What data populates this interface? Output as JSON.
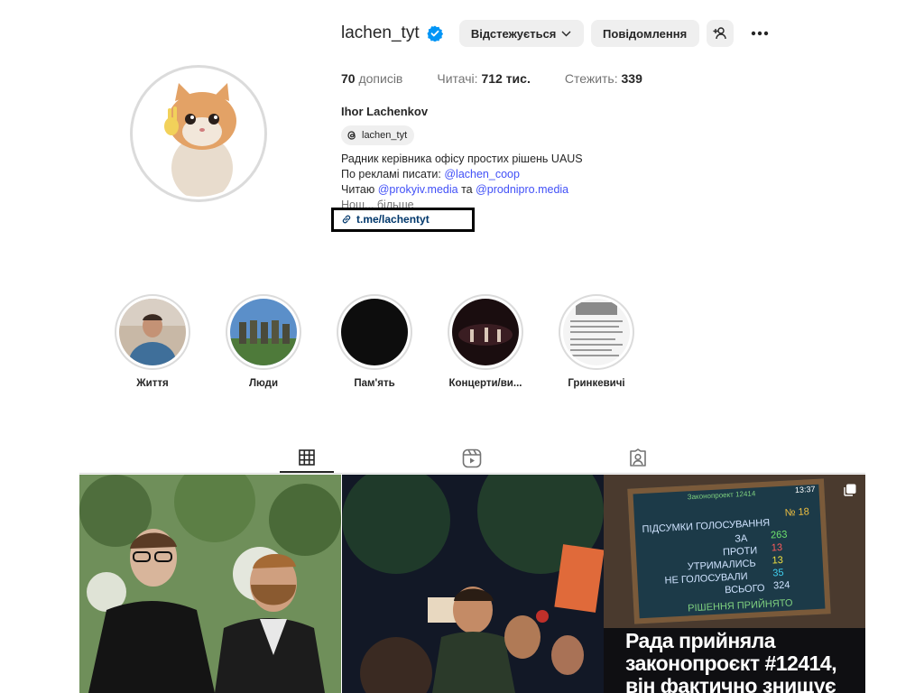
{
  "profile": {
    "username": "lachen_tyt",
    "verified": true,
    "follow_button": "Відстежується",
    "message_button": "Повідомлення",
    "posts_count": "70",
    "posts_label": "дописів",
    "followers_label": "Читачі:",
    "followers_count": "712 тис.",
    "following_label": "Стежить:",
    "following_count": "339",
    "full_name": "Ihor Lachenkov",
    "threads_handle": "lachen_tyt",
    "bio_line1": "Радник керівника офісу простих рішень UAUS",
    "bio_line2_prefix": "По рекламі писати:",
    "bio_line2_mention": "@lachen_coop",
    "bio_line3_prefix": "Читаю",
    "bio_line3_mention1": "@prokyiv.media",
    "bio_line3_mid": "та",
    "bio_line3_mention2": "@prodnipro.media",
    "bio_more": "Нош... більше",
    "link": "t.me/lachentyt"
  },
  "highlights": [
    {
      "label": "Життя"
    },
    {
      "label": "Люди"
    },
    {
      "label": "Пам'ять"
    },
    {
      "label": "Концерти/ви..."
    },
    {
      "label": "Гринкевичі"
    }
  ],
  "tabs": [
    {
      "icon": "grid-icon",
      "active": true
    },
    {
      "icon": "reels-icon",
      "active": false
    },
    {
      "icon": "tagged-icon",
      "active": false
    }
  ],
  "posts": {
    "post3_caption_line1": "Рада прийняла",
    "post3_caption_line2": "законопроєкт #12414,",
    "post3_caption_line3": "він фактично знищує",
    "screen_title": "Законопроект 12414",
    "screen_time": "13:37",
    "screen_number": "№ 18",
    "screen_header": "ПІДСУМКИ ГОЛОСУВАННЯ",
    "vote_for_label": "ЗА",
    "vote_for": "263",
    "vote_against_label": "ПРОТИ",
    "vote_against": "13",
    "vote_abstain_label": "УТРИМАЛИСЬ",
    "vote_abstain": "13",
    "vote_none_label": "НЕ ГОЛОСУВАЛИ",
    "vote_none": "35",
    "vote_total_label": "ВСЬОГО",
    "vote_total": "324",
    "screen_result": "РІШЕННЯ ПРИЙНЯТО"
  },
  "colors": {
    "verified_blue": "#0095f6",
    "mention_blue": "#4150f7",
    "button_grey": "#efefef"
  }
}
